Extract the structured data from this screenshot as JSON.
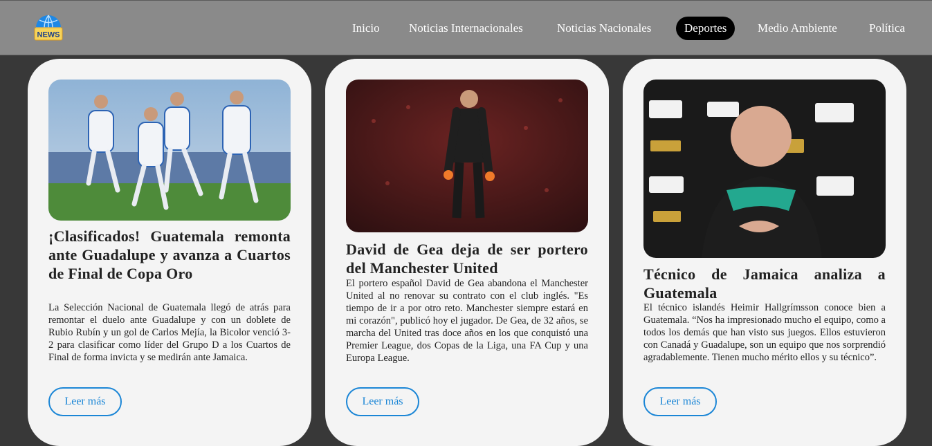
{
  "header": {
    "logo_text": "NEWS",
    "nav": [
      {
        "label": "Inicio"
      },
      {
        "label": "Noticias Internacionales"
      },
      {
        "label": "Noticias Nacionales"
      },
      {
        "label": "Deportes",
        "active": true
      },
      {
        "label": "Medio Ambiente"
      },
      {
        "label": "Política"
      }
    ]
  },
  "colors": {
    "nav_bg": "#8a8a8a",
    "page_bg": "#383838",
    "card_bg": "#f4f4f4",
    "button_accent": "#1b86d6",
    "active_tab": "#000000"
  },
  "articles": [
    {
      "image": "guatemala-players-celebrating",
      "title": "¡Clasificados! Guatemala remonta ante Guadalupe y avanza a Cuartos de Final de Copa Oro",
      "text": "La Selección Nacional de Guatemala llegó de atrás para remontar el duelo ante Guadalupe y con un doblete de Rubio Rubín y un gol de Carlos Mejía, la Bicolor venció 3-2 para clasificar como líder del Grupo D a los Cuartos de Final de forma invicta y se medirán ante Jamaica.",
      "button": "Leer más"
    },
    {
      "image": "goalkeeper-in-stadium",
      "title": "David de Gea deja de ser portero del Manchester United",
      "text": "El portero español David de Gea abandona el Manchester United al no renovar su contrato con el club inglés. \"Es tiempo de ir a por otro reto. Manchester siempre estará en mi corazón\", publicó hoy el jugador. De Gea, de 32 años, se marcha del United tras doce años en los que conquistó una Premier League, dos Copas de la Liga, una FA Cup y una Europa League.",
      "button": "Leer más"
    },
    {
      "image": "coach-press-conference",
      "title": "Técnico de Jamaica analiza a Guatemala",
      "text": "El técnico islandés Heimir Hallgrímsson conoce bien a Guatemala. “Nos ha impresionado mucho el equipo, como a todos los demás que han visto sus juegos. Ellos estuvieron con Canadá y Guadalupe, son un equipo que nos sorprendió agradablemente. Tienen mucho mérito ellos y su técnico”.",
      "button": "Leer más"
    }
  ]
}
